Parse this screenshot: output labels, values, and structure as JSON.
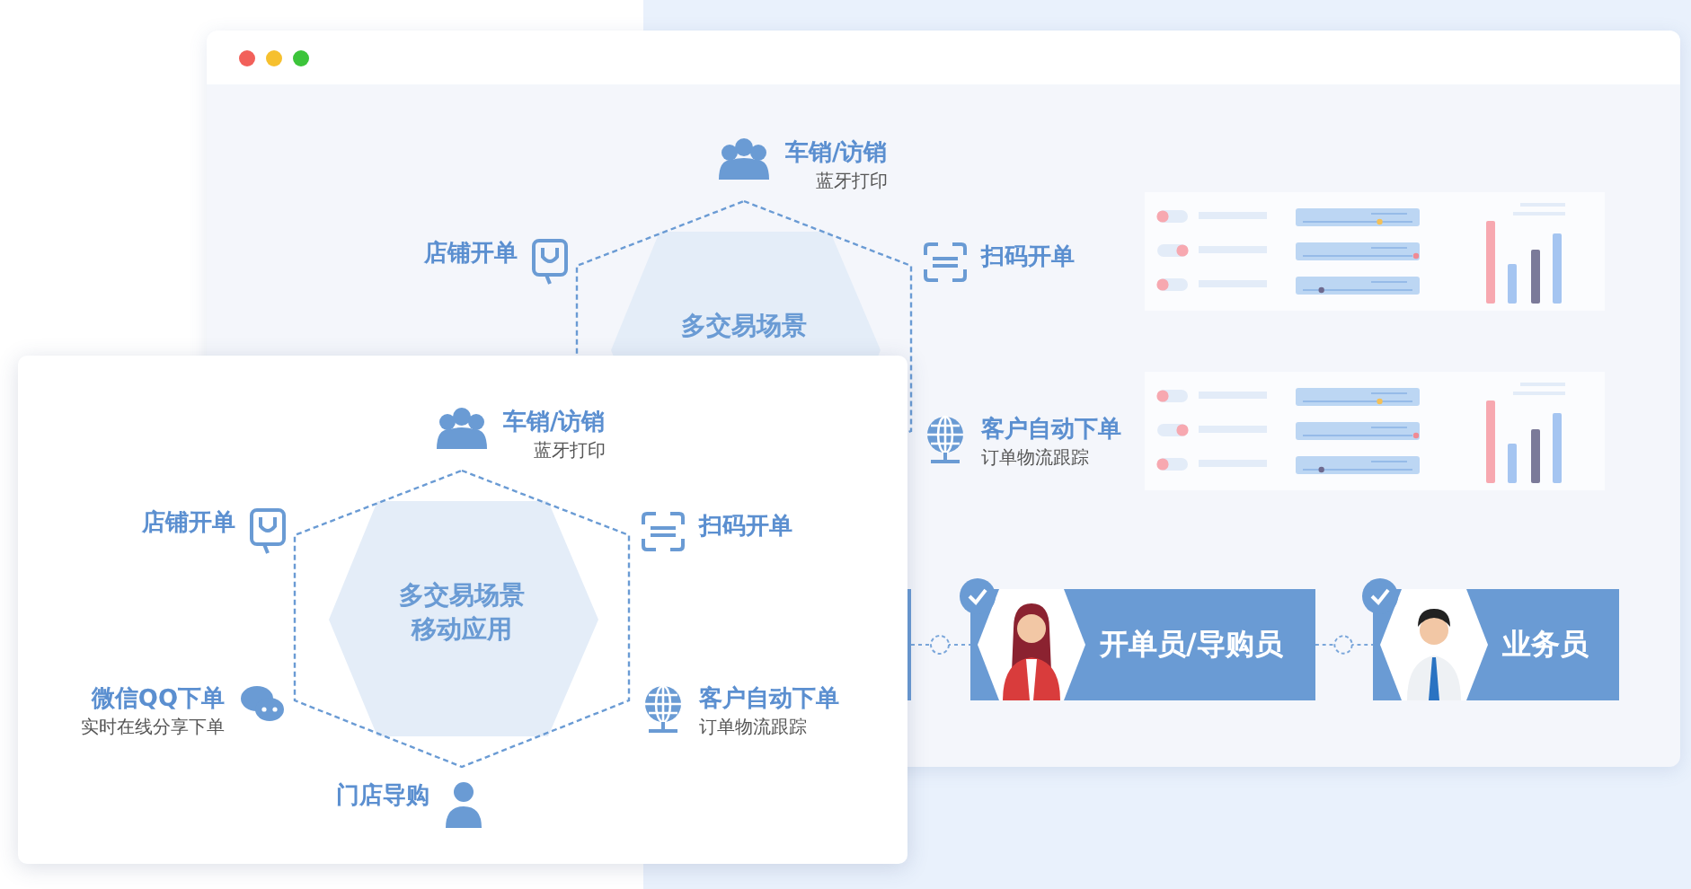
{
  "back_window": {
    "diagram": {
      "center": [
        "多交易场景"
      ],
      "nodes": [
        {
          "kind": "top",
          "title": "车销/访销",
          "subtitle": "蓝牙打印"
        },
        {
          "kind": "upper_left",
          "title": "店铺开单"
        },
        {
          "kind": "upper_right",
          "title": "扫码开单"
        },
        {
          "kind": "lower_right",
          "title": "客户自动下单",
          "subtitle": "订单物流跟踪"
        }
      ]
    },
    "flow": {
      "cards": [
        {
          "label": "开单员/导购员",
          "checked": true,
          "kind": "woman"
        },
        {
          "label": "业务员",
          "checked": true,
          "kind": "man"
        }
      ]
    }
  },
  "front_card": {
    "diagram": {
      "center": [
        "多交易场景",
        "移动应用"
      ],
      "nodes": [
        {
          "kind": "top",
          "title": "车销/访销",
          "subtitle": "蓝牙打印"
        },
        {
          "kind": "upper_left",
          "title": "店铺开单"
        },
        {
          "kind": "upper_right",
          "title": "扫码开单"
        },
        {
          "kind": "lower_left",
          "title": "微信QQ下单",
          "subtitle": "实时在线分享下单"
        },
        {
          "kind": "lower_right",
          "title": "客户自动下单",
          "subtitle": "订单物流跟踪"
        },
        {
          "kind": "bottom",
          "title": "门店导购"
        }
      ]
    }
  }
}
